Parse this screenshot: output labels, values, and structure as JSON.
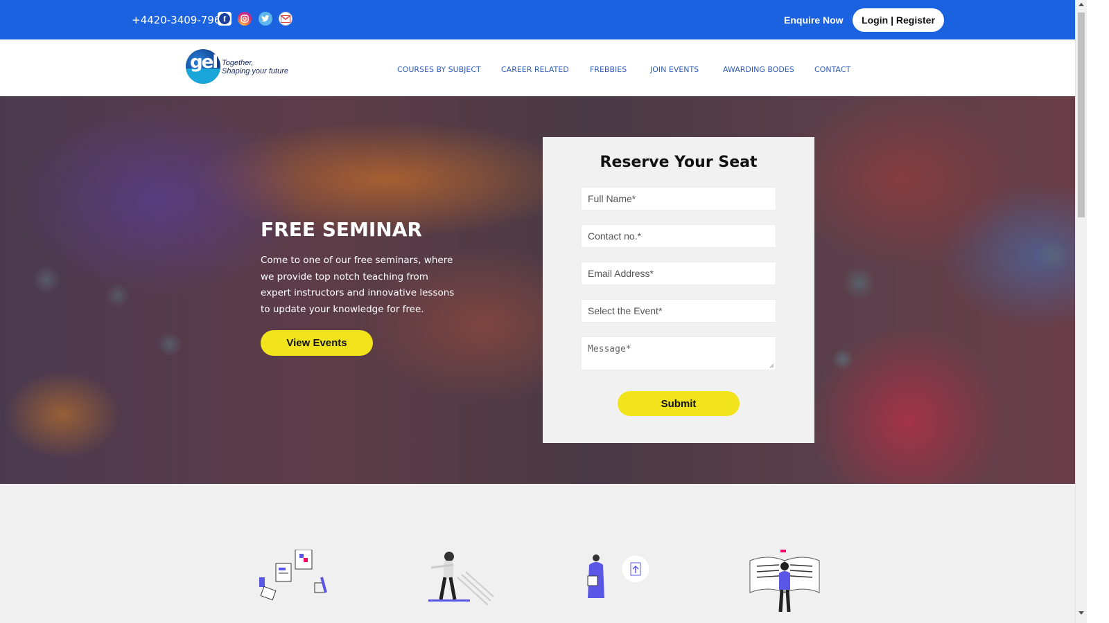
{
  "topbar": {
    "phone": "+4420-3409-7966",
    "social": [
      {
        "icon": "facebook-icon",
        "glyph": "f"
      },
      {
        "icon": "instagram-icon",
        "glyph": "◎"
      },
      {
        "icon": "twitter-icon",
        "glyph": "🐦"
      },
      {
        "icon": "gmail-icon",
        "glyph": "✉"
      }
    ],
    "enquire_label": "Enquire Now",
    "login_label": "Login | Register",
    "bg_color": "#1a62e0"
  },
  "nav": {
    "logo_text": "gel",
    "tagline_line1": "Together,",
    "tagline_line2": "Shaping your future",
    "links": [
      "COURSES BY SUBJECT",
      "CAREER RELATED",
      "FREBBIES",
      "JOIN EVENTS",
      "AWARDING BODES",
      "CONTACT"
    ]
  },
  "hero": {
    "title": "FREE SEMINAR",
    "description": "Come to one of our free seminars, where we provide top notch teaching from expert instructors and innovative lessons to update your knowledge for free.",
    "cta_label": "View Events",
    "accent_color": "#f1e41c"
  },
  "form": {
    "title": "Reserve Your Seat",
    "full_name_placeholder": "Full Name*",
    "contact_placeholder": "Contact no.*",
    "email_placeholder": "Email Address*",
    "event_placeholder": "Select the Event*",
    "message_placeholder": "Message*",
    "submit_label": "Submit"
  }
}
